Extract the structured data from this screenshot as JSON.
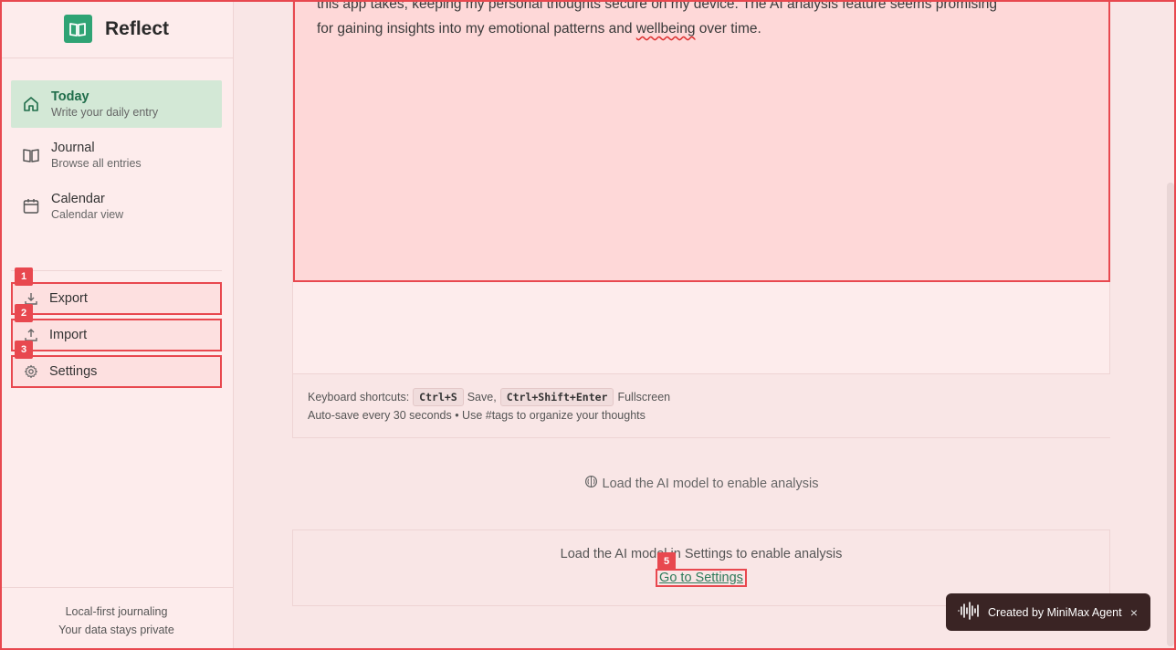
{
  "brand": {
    "name": "Reflect",
    "logo_icon": "book-open-icon",
    "accent": "#2fa374"
  },
  "nav": [
    {
      "label": "Today",
      "sub": "Write your daily entry",
      "icon": "home-icon",
      "active": true
    },
    {
      "label": "Journal",
      "sub": "Browse all entries",
      "icon": "book-icon",
      "active": false
    },
    {
      "label": "Calendar",
      "sub": "Calendar view",
      "icon": "calendar-icon",
      "active": false
    }
  ],
  "tools": [
    {
      "badge": "1",
      "label": "Export",
      "icon": "download-icon"
    },
    {
      "badge": "2",
      "label": "Import",
      "icon": "upload-icon"
    },
    {
      "badge": "3",
      "label": "Settings",
      "icon": "gear-icon"
    }
  ],
  "sidebar_footer": {
    "line1": "Local-first journaling",
    "line2": "Your data stays private"
  },
  "editor": {
    "text_line1": "this app takes, keeping my personal thoughts secure on my device. The AI analysis feature seems promising",
    "text_line2_pre": "for gaining insights into my emotional patterns and ",
    "text_line2_misspelled": "wellbeing",
    "text_line2_post": " over time."
  },
  "shortcuts": {
    "prefix": "Keyboard shortcuts:",
    "save_key": "Ctrl+S",
    "save_label": "Save,",
    "fullscreen_key": "Ctrl+Shift+Enter",
    "fullscreen_label": "Fullscreen",
    "autosave": "Auto-save every 30 seconds • Use #tags to organize your thoughts"
  },
  "ai": {
    "hint": "Load the AI model to enable analysis",
    "card_text": "Load the AI model in Settings to enable analysis",
    "link_badge": "5",
    "link_label": "Go to Settings"
  },
  "toast": {
    "text": "Created by MiniMax Agent",
    "close": "×"
  }
}
